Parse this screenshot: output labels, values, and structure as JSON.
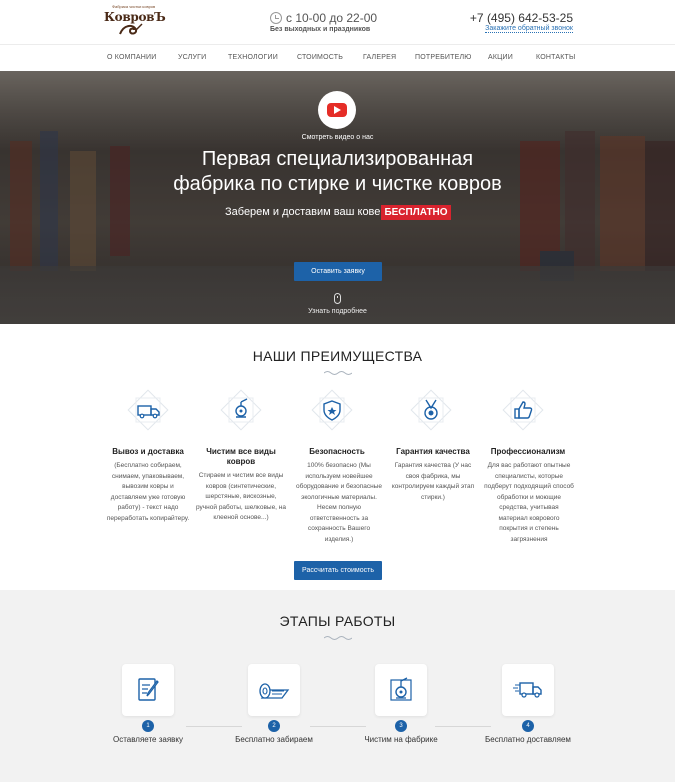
{
  "header": {
    "logo_text": "КовровЪ",
    "logo_tagline": "Фабрика чистки ковров",
    "hours_main": "с 10-00 до 22-00",
    "hours_sub": "Без выходных и праздников",
    "phone": "+7 (495) 642-53-25",
    "callback": "Закажите обратный звонок"
  },
  "nav": [
    "О КОМПАНИИ",
    "УСЛУГИ",
    "ТЕХНОЛОГИИ",
    "СТОИМОСТЬ",
    "ГАЛЕРЕЯ",
    "ПОТРЕБИТЕЛЮ",
    "АКЦИИ",
    "КОНТАКТЫ"
  ],
  "hero": {
    "video_label": "Смотреть видео о нас",
    "title_line1": "Первая специализированная",
    "title_line2": "фабрика по стирке и чистке ковров",
    "subtitle": "Заберем и доставим ваш ковер",
    "badge": "БЕСПЛАТНО",
    "button": "Оставить заявку",
    "learn_more": "Узнать подробнее"
  },
  "advantages": {
    "title": "НАШИ ПРЕИМУЩЕСТВА",
    "items": [
      {
        "icon": "truck-icon",
        "title": "Вывоз и доставка",
        "text": "(Бесплатно собираем, снимаем, упаковываем, вывозим ковры и доставляем уже готовую работу) - текст надо переработать копирайтеру."
      },
      {
        "icon": "washing-machine-icon",
        "title": "Чистим все виды ковров",
        "text": "Стираем и чистим все виды ковров (синтетические, шерстяные, вискозные, ручной работы, шелковые, на клееной основе...)"
      },
      {
        "icon": "shield-icon",
        "title": "Безопасность",
        "text": "100% безопасно (Мы используем новейшее оборудование и безопасные экологичные материалы. Несем полную ответственность за сохранность Вашего изделия.)"
      },
      {
        "icon": "medal-icon",
        "title": "Гарантия качества",
        "text": "Гарантия качества (У нас своя фабрика, мы контролируем каждый этап стирки.)"
      },
      {
        "icon": "thumbs-up-icon",
        "title": "Профессионализм",
        "text": "Для вас работают опытные специалисты, которые подберут подходящий способ обработки и моющие средства, учитывая материал коврового покрытия и степень загрязнения"
      }
    ],
    "button": "Рассчитать стоимость"
  },
  "stages": {
    "title": "ЭТАПЫ РАБОТЫ",
    "items": [
      {
        "num": "1",
        "icon": "form-pen-icon",
        "label": "Оставляете заявку"
      },
      {
        "num": "2",
        "icon": "rolled-carpet-icon",
        "label": "Бесплатно забираем"
      },
      {
        "num": "3",
        "icon": "cleaning-machine-icon",
        "label": "Чистим на фабрике"
      },
      {
        "num": "4",
        "icon": "delivery-truck-icon",
        "label": "Бесплатно доставляем"
      }
    ]
  },
  "colors": {
    "accent": "#1d62a8",
    "badge_red": "#d9232e",
    "youtube_red": "#e52d27"
  }
}
